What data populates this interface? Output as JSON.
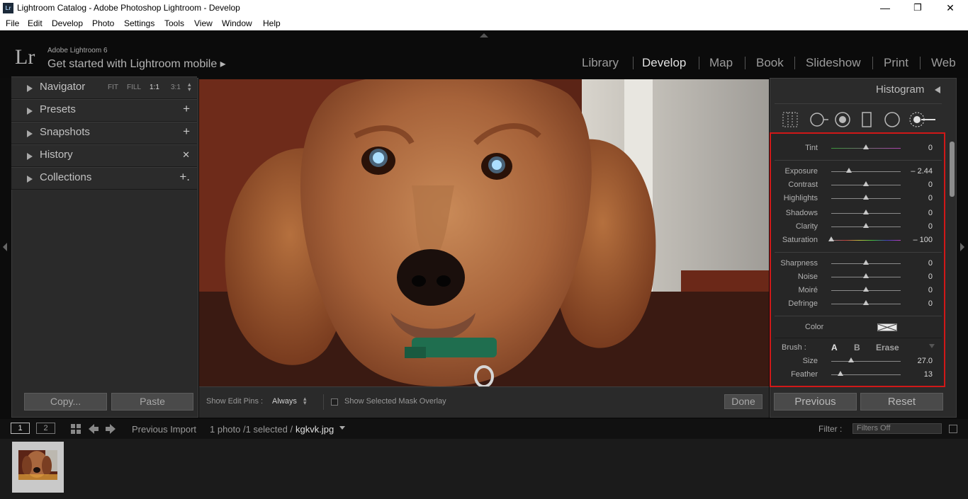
{
  "titlebar": {
    "app_icon": "Lr",
    "title": "Lightroom Catalog - Adobe Photoshop Lightroom - Develop",
    "minimize": "—",
    "restore": "❐",
    "close": "✕"
  },
  "menu": [
    "File",
    "Edit",
    "Develop",
    "Photo",
    "Settings",
    "Tools",
    "View",
    "Window",
    "Help"
  ],
  "identity": {
    "logo": "Lr",
    "version": "Adobe Lightroom 6",
    "mobile_prompt": "Get started with Lightroom mobile ▸"
  },
  "modules": [
    "Library",
    "Develop",
    "Map",
    "Book",
    "Slideshow",
    "Print",
    "Web"
  ],
  "active_module": "Develop",
  "left_panel": {
    "sections": [
      {
        "label": "Navigator",
        "action": ""
      },
      {
        "label": "Presets",
        "action": "+"
      },
      {
        "label": "Snapshots",
        "action": "+"
      },
      {
        "label": "History",
        "action": "✕"
      },
      {
        "label": "Collections",
        "action": "+."
      }
    ],
    "navigator_options": [
      "FIT",
      "FILL",
      "1:1",
      "3:1"
    ],
    "copy_label": "Copy...",
    "paste_label": "Paste"
  },
  "toolbar": {
    "edit_pins_label": "Show Edit Pins :",
    "edit_pins_value": "Always",
    "mask_overlay_label": "Show Selected Mask Overlay",
    "done_label": "Done"
  },
  "right_panel": {
    "histogram_label": "Histogram",
    "sliders": [
      {
        "label": "Tint",
        "value": "0",
        "position": 0.5
      },
      {
        "label": "Exposure",
        "value": "– 2.44",
        "position": 0.25
      },
      {
        "label": "Contrast",
        "value": "0",
        "position": 0.5
      },
      {
        "label": "Highlights",
        "value": "0",
        "position": 0.5
      },
      {
        "label": "Shadows",
        "value": "0",
        "position": 0.5
      },
      {
        "label": "Clarity",
        "value": "0",
        "position": 0.5
      },
      {
        "label": "Saturation",
        "value": "– 100",
        "position": 0.0
      },
      {
        "label": "Sharpness",
        "value": "0",
        "position": 0.5
      },
      {
        "label": "Noise",
        "value": "0",
        "position": 0.5
      },
      {
        "label": "Moiré",
        "value": "0",
        "position": 0.5
      },
      {
        "label": "Defringe",
        "value": "0",
        "position": 0.5
      }
    ],
    "color_label": "Color",
    "brush": {
      "label": "Brush :",
      "a": "A",
      "b": "B",
      "erase": "Erase",
      "size_label": "Size",
      "size_value": "27.0",
      "size_position": 0.29,
      "feather_label": "Feather",
      "feather_value": "13",
      "feather_position": 0.13
    },
    "previous_label": "Previous",
    "reset_label": "Reset"
  },
  "filmstrip": {
    "view1": "1",
    "view2": "2",
    "source": "Previous Import",
    "count": "1 photo /1 selected /",
    "filename": "kgkvk.jpg",
    "filter_label": "Filter :",
    "filter_value": "Filters Off"
  }
}
